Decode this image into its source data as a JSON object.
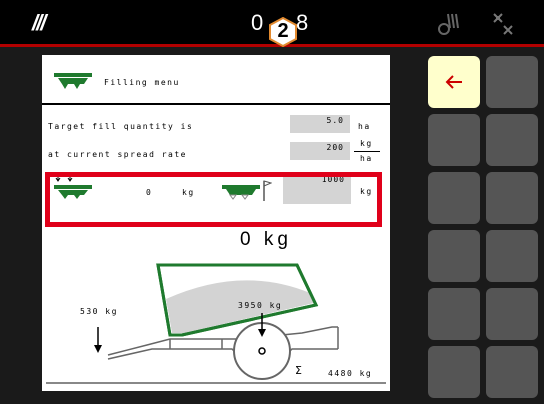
{
  "status_bar": {
    "brand_mark": "///",
    "time_left": "0",
    "badge_number": "2",
    "time_right": "8"
  },
  "menu": {
    "title": "Filling menu",
    "target_label": "Target fill quantity is",
    "rate_label": "at current spread rate",
    "target_value": "5.0",
    "target_unit": "ha",
    "rate_value": "200",
    "rate_unit_top": "kg",
    "rate_unit_bottom": "ha",
    "hopper_amount": "0",
    "hopper_unit": "kg",
    "fill_value": "1000",
    "fill_unit": "kg",
    "big_weight": "0 kg"
  },
  "trailer": {
    "drawbar_load": "530 kg",
    "hopper_load": "3950 kg",
    "sum_symbol": "Σ",
    "total_load": "4480 kg"
  },
  "colors": {
    "accent_red": "#e0001a",
    "spreader_green": "#1f7a2e",
    "back_arrow": "#cc0000"
  },
  "side_buttons": {
    "back_icon": "arrow-left-icon"
  }
}
